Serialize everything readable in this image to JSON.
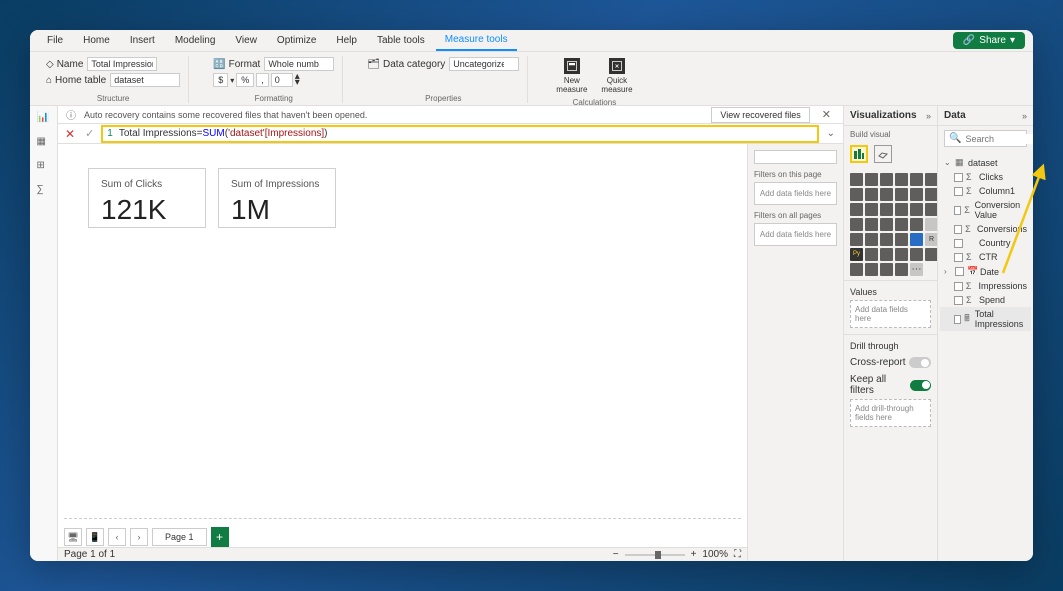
{
  "menubar": {
    "tabs": [
      "File",
      "Home",
      "Insert",
      "Modeling",
      "View",
      "Optimize",
      "Help",
      "Table tools",
      "Measure tools"
    ],
    "active": "Measure tools",
    "share": "Share"
  },
  "ribbon": {
    "structure": {
      "name_label": "Name",
      "name_value": "Total Impressions",
      "home_table_label": "Home table",
      "home_table_value": "dataset",
      "group_label": "Structure"
    },
    "formatting": {
      "format_label": "Format",
      "format_value": "Whole number",
      "currency": "$",
      "percent": "%",
      "comma": ",",
      "decimals": "0",
      "group_label": "Formatting"
    },
    "properties": {
      "data_category_label": "Data category",
      "data_category_value": "Uncategorized",
      "group_label": "Properties"
    },
    "calculations": {
      "new_measure": "New\nmeasure",
      "quick_measure": "Quick\nmeasure",
      "group_label": "Calculations"
    }
  },
  "recovery": {
    "text": "Auto recovery contains some recovered files that haven't been opened.",
    "button": "View recovered files"
  },
  "formula": {
    "line_no": "1",
    "measure_name": "Total Impressions",
    "equals": " = ",
    "func": "SUM",
    "open": "(",
    "table_ref": "'dataset'",
    "col_ref": "[Impressions]",
    "close": ")"
  },
  "canvas": {
    "card1": {
      "title": "Sum of Clicks",
      "value": "121K"
    },
    "card2": {
      "title": "Sum of Impressions",
      "value": "1M"
    },
    "page_tab": "Page 1"
  },
  "statusbar": {
    "page": "Page 1 of 1",
    "zoom": "100%"
  },
  "filters": {
    "on_page": "Filters on this page",
    "on_all": "Filters on all pages",
    "add": "Add data fields here"
  },
  "vis": {
    "title": "Visualizations",
    "build": "Build visual",
    "values": "Values",
    "add_fields": "Add data fields here",
    "drill": "Drill through",
    "cross": "Cross-report",
    "cross_state": "Off",
    "keep": "Keep all filters",
    "keep_state": "On",
    "add_drill": "Add drill-through fields here"
  },
  "data": {
    "title": "Data",
    "search_placeholder": "Search",
    "table": "dataset",
    "fields": [
      {
        "name": "Clicks",
        "type": "sigma"
      },
      {
        "name": "Column1",
        "type": "sigma"
      },
      {
        "name": "Conversion Value",
        "type": "sigma"
      },
      {
        "name": "Conversions",
        "type": "sigma"
      },
      {
        "name": "Country",
        "type": "text"
      },
      {
        "name": "CTR",
        "type": "sigma"
      },
      {
        "name": "Date",
        "type": "date"
      },
      {
        "name": "Impressions",
        "type": "sigma"
      },
      {
        "name": "Spend",
        "type": "sigma"
      },
      {
        "name": "Total Impressions",
        "type": "measure"
      }
    ]
  }
}
